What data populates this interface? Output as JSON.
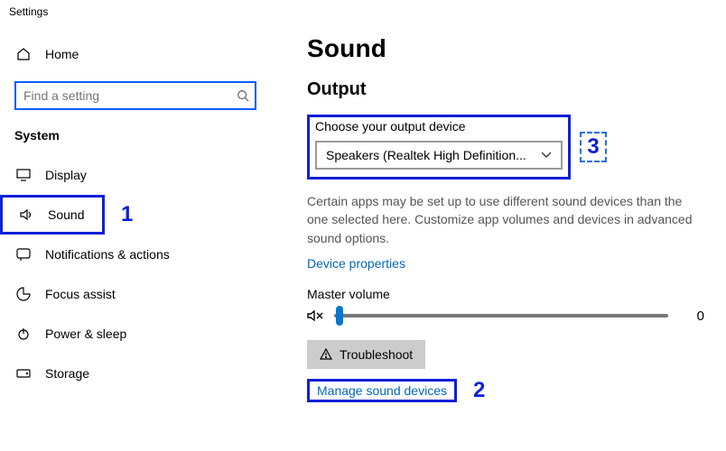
{
  "window_title": "Settings",
  "sidebar": {
    "home_label": "Home",
    "search_placeholder": "Find a setting",
    "section_label": "System",
    "items": [
      {
        "label": "Display"
      },
      {
        "label": "Sound"
      },
      {
        "label": "Notifications & actions"
      },
      {
        "label": "Focus assist"
      },
      {
        "label": "Power & sleep"
      },
      {
        "label": "Storage"
      }
    ],
    "annotation_1": "1"
  },
  "main": {
    "heading": "Sound",
    "output": {
      "section_title": "Output",
      "choose_label": "Choose your output device",
      "device_selected": "Speakers (Realtek High Definition...",
      "annotation_3": "3",
      "helper_text": "Certain apps may be set up to use different sound devices than the one selected here. Customize app volumes and devices in advanced sound options.",
      "device_properties_link": "Device properties",
      "master_volume_label": "Master volume",
      "master_volume_value": "0",
      "troubleshoot_label": "Troubleshoot",
      "manage_link": "Manage sound devices",
      "annotation_2": "2"
    }
  }
}
